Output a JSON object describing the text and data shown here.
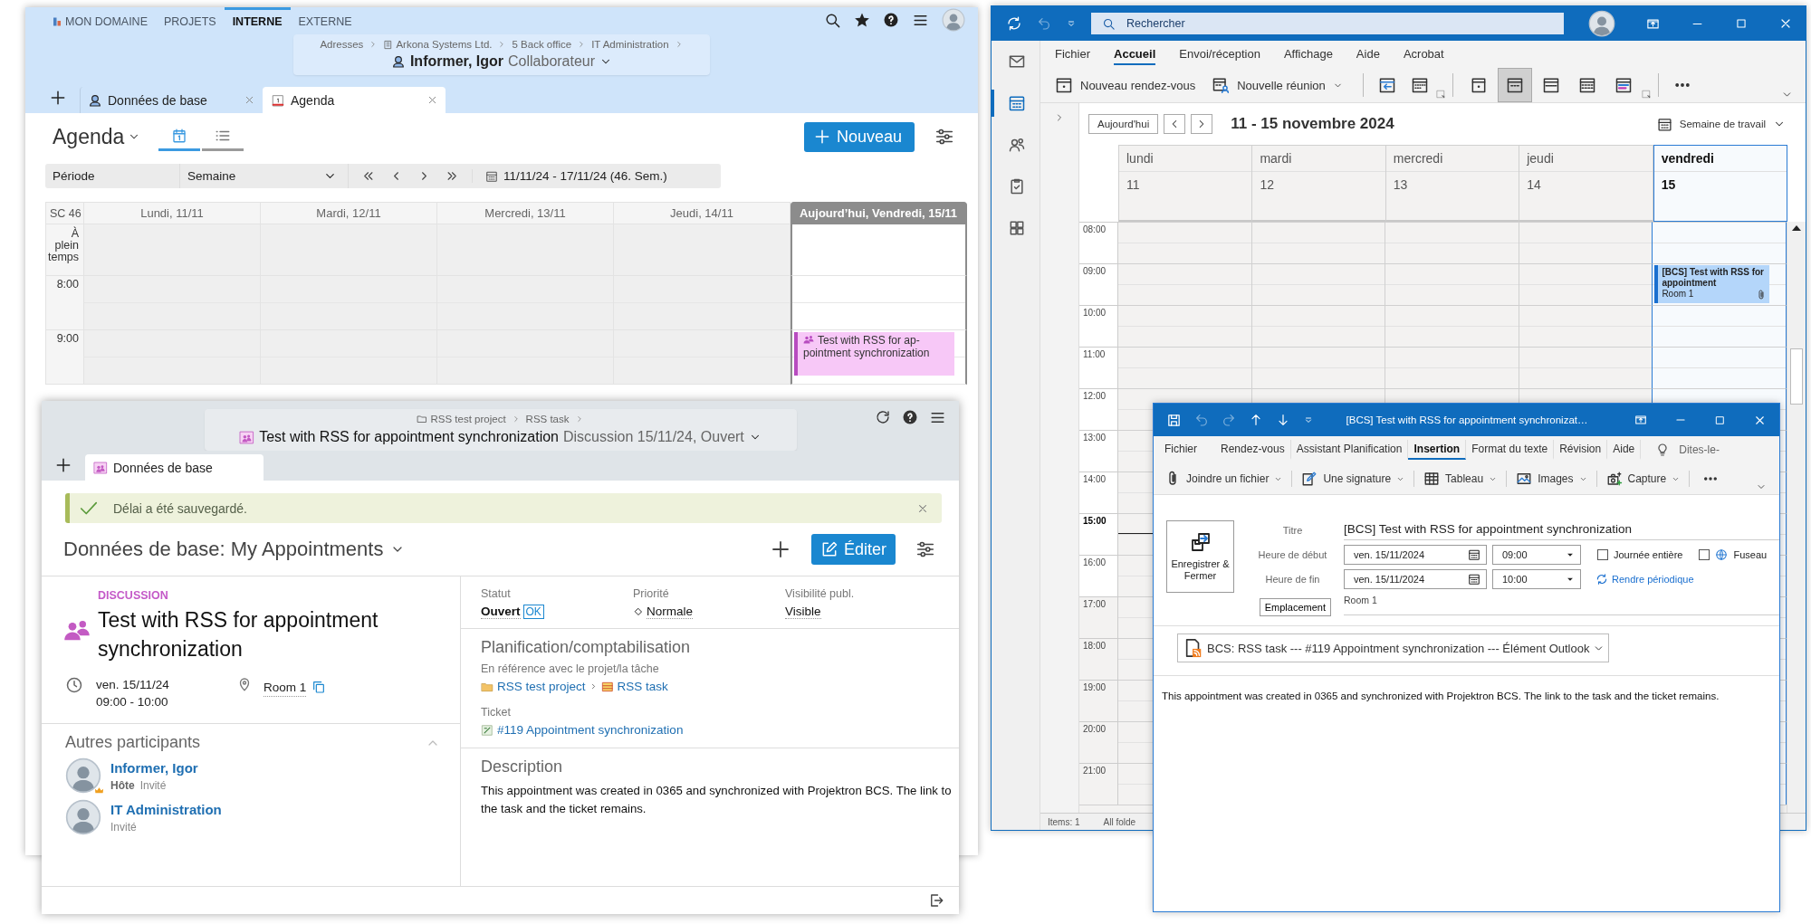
{
  "agenda_window": {
    "nav_tabs": [
      {
        "label": "MON DOMAINE",
        "kind": "domain",
        "selected": false
      },
      {
        "label": "PROJETS",
        "selected": false
      },
      {
        "label": "INTERNE",
        "selected": true
      },
      {
        "label": "EXTERNE",
        "selected": false
      }
    ],
    "breadcrumb": [
      {
        "label": "Adresses"
      },
      {
        "label": "Arkona Systems Ltd.",
        "kind": "company"
      },
      {
        "label": "5 Back office"
      },
      {
        "label": "IT Administration"
      }
    ],
    "record": {
      "name": "Informer, Igor",
      "type": "Collaborateur"
    },
    "tabs": [
      {
        "label": "Données de base",
        "kind": "person",
        "selected": false
      },
      {
        "label": "Agenda",
        "kind": "calendar",
        "selected": true
      }
    ],
    "title": "Agenda",
    "views": [
      {
        "kind": "calendar",
        "selected": true
      },
      {
        "kind": "list",
        "selected": false
      }
    ],
    "new_button": "Nouveau",
    "filter": {
      "label": "Période",
      "value": "Semaine",
      "range": "11/11/24 - 17/11/24 (46. Sem.)"
    },
    "calendar": {
      "week": "SC 46",
      "days": [
        {
          "label": "Lundi, 11/11",
          "today": false
        },
        {
          "label": "Mardi, 12/11",
          "today": false
        },
        {
          "label": "Mercredi, 13/11",
          "today": false
        },
        {
          "label": "Jeudi, 14/11",
          "today": false
        },
        {
          "label": "Aujourd’hui, Vendredi, 15/11",
          "today": true
        }
      ],
      "allday_label": "À plein temps",
      "hours": [
        {
          "label": "8:00"
        },
        {
          "label": "9:00",
          "cells": [
            {},
            {},
            {},
            {},
            {
              "event": "Test with RSS for ap-pointment synchronization"
            }
          ]
        }
      ]
    }
  },
  "detail_window": {
    "breadcrumb": [
      {
        "label": "RSS test project",
        "kind": "folder"
      },
      {
        "label": "RSS task"
      }
    ],
    "title": "Test with RSS for appointment synchronization",
    "subtitle": "Discussion 15/11/24, Ouvert",
    "tabs": [
      {
        "label": "Données de base",
        "selected": true
      }
    ],
    "notice": "Délai a été sauvegardé.",
    "heading": "Données de base: My Appointments",
    "edit_button": "Éditer",
    "category": "DISCUSSION",
    "appointment_title": "Test with RSS for appointment synchronization",
    "date": "ven. 15/11/24",
    "time": "09:00 - 10:00",
    "location": "Room 1",
    "participants_heading": "Autres participants",
    "participants": [
      {
        "name": "Informer, Igor",
        "role": "Hôte",
        "status": "Invité"
      },
      {
        "name": "IT Administration",
        "status": "Invité"
      }
    ],
    "fields": [
      {
        "label": "Statut",
        "value": "Ouvert",
        "badge": "OK"
      },
      {
        "label": "Priorité",
        "value": "Normale",
        "kind": "priority"
      },
      {
        "label": "Visibilité publ.",
        "value": "Visible"
      }
    ],
    "planning": {
      "heading": "Planification/comptabilisation",
      "reference_label": "En référence avec le projet/la tâche",
      "project": "RSS test project",
      "task": "RSS task",
      "ticket_label": "Ticket",
      "ticket": "#119 Appointment synchronization"
    },
    "description": {
      "heading": "Description",
      "text": "This appointment was created in 0365 and synchronized with Projektron BCS. The link to the task and the ticket remains."
    }
  },
  "outlook_window": {
    "search_placeholder": "Rechercher",
    "rail": [
      {
        "kind": "mail",
        "selected": false
      },
      {
        "kind": "calendar",
        "selected": true
      },
      {
        "kind": "people",
        "selected": false
      },
      {
        "kind": "tasks",
        "selected": false
      },
      {
        "kind": "apps",
        "selected": false
      }
    ],
    "menu": [
      {
        "label": "Fichier",
        "selected": false
      },
      {
        "label": "Accueil",
        "selected": true
      },
      {
        "label": "Envoi/réception",
        "selected": false
      },
      {
        "label": "Affichage",
        "selected": false
      },
      {
        "label": "Aide",
        "selected": false
      },
      {
        "label": "Acrobat",
        "selected": false
      }
    ],
    "ribbon": [
      {
        "label": "Nouveau rendez-vous",
        "kind": "appointment"
      },
      {
        "label": "Nouvelle réunion",
        "kind": "meeting"
      }
    ],
    "views": [
      {
        "kind": "day",
        "selected": false
      },
      {
        "kind": "workweek",
        "selected": true
      },
      {
        "kind": "week",
        "selected": false
      },
      {
        "kind": "month",
        "selected": false
      },
      {
        "kind": "schedule",
        "selected": false
      }
    ],
    "today_button": "Aujourd'hui",
    "range": "11 - 15 novembre 2024",
    "view": "Semaine de travail",
    "days": [
      {
        "name": "lundi",
        "date": "11",
        "today": false
      },
      {
        "name": "mardi",
        "date": "12",
        "today": false
      },
      {
        "name": "mercredi",
        "date": "13",
        "today": false
      },
      {
        "name": "jeudi",
        "date": "14",
        "today": false
      },
      {
        "name": "vendredi",
        "date": "15",
        "today": true
      }
    ],
    "hours": [
      {
        "label": "08:00",
        "working": true,
        "current": false
      },
      {
        "label": "09:00",
        "working": true,
        "current": false,
        "cells": [
          {},
          {},
          {},
          {},
          {
            "event": {
              "title": "[BCS] Test with RSS for appointment",
              "location": "Room 1"
            }
          }
        ]
      },
      {
        "label": "10:00",
        "working": true,
        "current": false
      },
      {
        "label": "11:00",
        "working": true,
        "current": false
      },
      {
        "label": "12:00",
        "working": true,
        "current": false
      },
      {
        "label": "13:00",
        "working": true,
        "current": false
      },
      {
        "label": "14:00",
        "working": true,
        "current": false
      },
      {
        "label": "15:00",
        "working": true,
        "current": true
      },
      {
        "label": "16:00",
        "working": true,
        "current": false
      },
      {
        "label": "17:00",
        "working": false,
        "current": false
      },
      {
        "label": "18:00",
        "working": false,
        "current": false
      },
      {
        "label": "19:00",
        "working": false,
        "current": false
      },
      {
        "label": "20:00",
        "working": false,
        "current": false
      },
      {
        "label": "21:00",
        "working": false,
        "current": false
      }
    ],
    "status": [
      "Items: 1",
      "All folde"
    ]
  },
  "appointment_window": {
    "title": "[BCS] Test with RSS for appointment synchronizat…",
    "menu": [
      {
        "label": "Fichier",
        "selected": false
      },
      {
        "label": "Rendez-vous",
        "selected": false
      },
      {
        "label": "Assistant Planification",
        "selected": false
      },
      {
        "label": "Insertion",
        "selected": true
      },
      {
        "label": "Format du texte",
        "selected": false
      },
      {
        "label": "Révision",
        "selected": false
      },
      {
        "label": "Aide",
        "selected": false
      }
    ],
    "tell_me": "Dites-le-",
    "ribbon": [
      {
        "label": "Joindre un fichier",
        "kind": "attach"
      },
      {
        "label": "Une signature",
        "kind": "signature"
      },
      {
        "label": "Tableau",
        "kind": "table"
      },
      {
        "label": "Images",
        "kind": "image"
      },
      {
        "label": "Capture",
        "kind": "capture"
      }
    ],
    "save_button": "Enregistrer & Fermer",
    "subject_label": "Titre",
    "subject": "[BCS] Test with RSS for appointment synchronization",
    "start": {
      "label": "Heure de début",
      "date": "ven. 15/11/2024",
      "time": "09:00"
    },
    "end": {
      "label": "Heure de fin",
      "date": "ven. 15/11/2024",
      "time": "10:00"
    },
    "all_day": {
      "label": "Journée entière",
      "checked": false
    },
    "timezone": {
      "label": "Fuseau",
      "checked": false
    },
    "recurrence": "Rendre périodique",
    "location_button": "Emplacement",
    "location": "Room 1",
    "link": "BCS: RSS task --- #119 Appointment synchronization --- Élément Outlook",
    "body": "This appointment was created in 0365 and synchronized with Projektron BCS. The link to the task and the ticket remains."
  }
}
